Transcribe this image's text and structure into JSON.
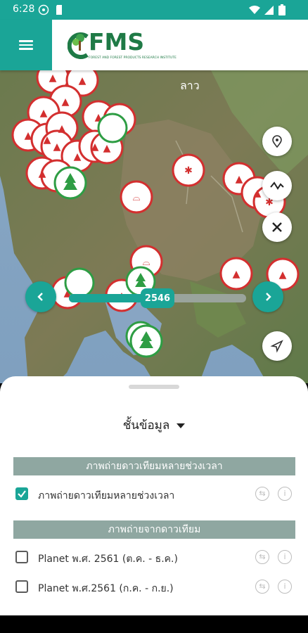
{
  "status_bar": {
    "time": "6:28"
  },
  "app": {
    "logo_text": "FMS",
    "logo_subtitle": "FOREST AND FOREST PRODUCTS RESEARCH INSTITUTE"
  },
  "map": {
    "labels": {
      "laos": "ลาว"
    },
    "year_slider": {
      "value": "2546",
      "progress": 0.5
    }
  },
  "sheet": {
    "layer_title": "ชั้นข้อมูล",
    "section1": {
      "header": "ภาพถ่ายดาวเทียมหลายช่วงเวลา",
      "items": [
        {
          "label": "ภาพถ่ายดาวเทียมหลายช่วงเวลา",
          "checked": true
        }
      ]
    },
    "section2": {
      "header": "ภาพถ่ายจากดาวเทียม",
      "items": [
        {
          "label": "Planet พ.ศ. 2561 (ต.ค. - ธ.ค.)",
          "checked": false
        },
        {
          "label": "Planet พ.ศ.2561 (ก.ค. - ก.ย.)",
          "checked": false
        }
      ]
    }
  },
  "colors": {
    "accent": "#1aa597",
    "marker_red": "#d32f2f",
    "marker_green": "#2e9d44"
  }
}
